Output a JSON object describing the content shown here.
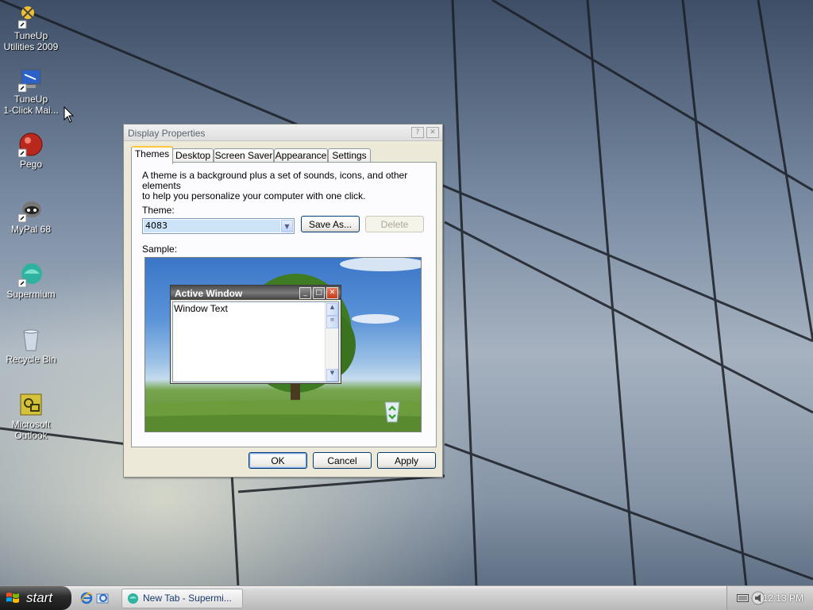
{
  "desktop_icons": [
    {
      "label_line1": "TuneUp",
      "label_line2": "Utilities 2009",
      "icon": "tuneup-utilities-icon"
    },
    {
      "label_line1": "TuneUp",
      "label_line2": "1-Click Mai...",
      "icon": "tuneup-1click-icon"
    },
    {
      "label_line1": "Pego",
      "label_line2": "",
      "icon": "pego-icon"
    },
    {
      "label_line1": "MyPal 68",
      "label_line2": "",
      "icon": "mypal-icon"
    },
    {
      "label_line1": "Supermium",
      "label_line2": "",
      "icon": "supermium-icon"
    },
    {
      "label_line1": "Recycle Bin",
      "label_line2": "",
      "icon": "recycle-bin-icon"
    },
    {
      "label_line1": "Microsoft",
      "label_line2": "Outlook",
      "icon": "outlook-icon"
    }
  ],
  "dialog": {
    "title": "Display Properties",
    "title_buttons": {
      "help": "?",
      "close": "✕"
    },
    "tabs": [
      {
        "label": "Themes",
        "active": true
      },
      {
        "label": "Desktop",
        "active": false
      },
      {
        "label": "Screen Saver",
        "active": false
      },
      {
        "label": "Appearance",
        "active": false
      },
      {
        "label": "Settings",
        "active": false
      }
    ],
    "description_line1": "A theme is a background plus a set of sounds, icons, and other elements",
    "description_line2": "to help you personalize your computer with one click.",
    "theme_label": "Theme:",
    "theme_value": "4083",
    "save_as_label": "Save As...",
    "delete_label": "Delete",
    "sample_label": "Sample:",
    "sample_window": {
      "title": "Active Window",
      "text": "Window Text"
    },
    "ok_label": "OK",
    "cancel_label": "Cancel",
    "apply_label": "Apply"
  },
  "taskbar": {
    "start_label": "start",
    "quick_launch": [
      "internet-explorer-icon",
      "outlook-express-icon"
    ],
    "tasks": [
      {
        "label": "New Tab - Supermi...",
        "icon": "supermium-icon"
      }
    ],
    "clock": "12:13 PM"
  },
  "colors": {
    "taskbar_start": "#1a1a1a",
    "active_tab_accent": "#ffc83c",
    "selection": "#cde3f7"
  }
}
